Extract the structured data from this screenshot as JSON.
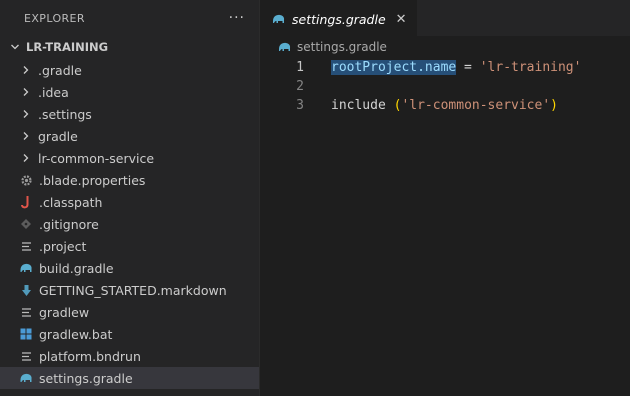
{
  "sidebar": {
    "title": "EXPLORER",
    "more": "···",
    "project": "LR-TRAINING",
    "folders": [
      ".gradle",
      ".idea",
      ".settings",
      "gradle",
      "lr-common-service"
    ],
    "files": [
      {
        "name": ".blade.properties",
        "icon": "gear-icon"
      },
      {
        "name": ".classpath",
        "icon": "java-icon"
      },
      {
        "name": ".gitignore",
        "icon": "git-diamond-icon"
      },
      {
        "name": ".project",
        "icon": "lines-icon"
      },
      {
        "name": "build.gradle",
        "icon": "gradle-elephant-icon"
      },
      {
        "name": "GETTING_STARTED.markdown",
        "icon": "markdown-arrow-icon"
      },
      {
        "name": "gradlew",
        "icon": "lines-icon"
      },
      {
        "name": "gradlew.bat",
        "icon": "windows-icon"
      },
      {
        "name": "platform.bndrun",
        "icon": "lines-icon"
      },
      {
        "name": "settings.gradle",
        "icon": "gradle-elephant-icon"
      }
    ]
  },
  "editor": {
    "tab": {
      "label": "settings.gradle",
      "close": "✕"
    },
    "breadcrumb": "settings.gradle",
    "lines": [
      {
        "num": "1",
        "var": "rootProject.name",
        "op": " = ",
        "str": "'lr-training'"
      },
      {
        "num": "2"
      },
      {
        "num": "3",
        "kw": "include ",
        "open": "(",
        "str": "'lr-common-service'",
        "close": ")"
      }
    ]
  },
  "colors": {
    "gradle": "#5aaecf",
    "java": "#e0554a",
    "markdown": "#519aba",
    "selection": "#264f78"
  }
}
